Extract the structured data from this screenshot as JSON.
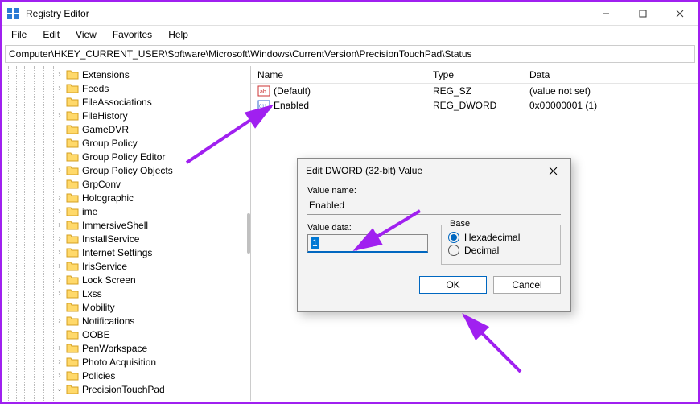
{
  "window": {
    "title": "Registry Editor"
  },
  "menu": {
    "items": [
      "File",
      "Edit",
      "View",
      "Favorites",
      "Help"
    ]
  },
  "address": "Computer\\HKEY_CURRENT_USER\\Software\\Microsoft\\Windows\\CurrentVersion\\PrecisionTouchPad\\Status",
  "tree": {
    "items": [
      {
        "label": "Extensions",
        "exp": "closed"
      },
      {
        "label": "Feeds",
        "exp": "closed"
      },
      {
        "label": "FileAssociations",
        "exp": "none"
      },
      {
        "label": "FileHistory",
        "exp": "closed"
      },
      {
        "label": "GameDVR",
        "exp": "none"
      },
      {
        "label": "Group Policy",
        "exp": "none"
      },
      {
        "label": "Group Policy Editor",
        "exp": "none"
      },
      {
        "label": "Group Policy Objects",
        "exp": "closed"
      },
      {
        "label": "GrpConv",
        "exp": "none"
      },
      {
        "label": "Holographic",
        "exp": "closed"
      },
      {
        "label": "ime",
        "exp": "closed"
      },
      {
        "label": "ImmersiveShell",
        "exp": "closed"
      },
      {
        "label": "InstallService",
        "exp": "closed"
      },
      {
        "label": "Internet Settings",
        "exp": "closed"
      },
      {
        "label": "IrisService",
        "exp": "closed"
      },
      {
        "label": "Lock Screen",
        "exp": "closed"
      },
      {
        "label": "Lxss",
        "exp": "closed"
      },
      {
        "label": "Mobility",
        "exp": "none"
      },
      {
        "label": "Notifications",
        "exp": "closed"
      },
      {
        "label": "OOBE",
        "exp": "none"
      },
      {
        "label": "PenWorkspace",
        "exp": "closed"
      },
      {
        "label": "Photo Acquisition",
        "exp": "closed"
      },
      {
        "label": "Policies",
        "exp": "closed"
      },
      {
        "label": "PrecisionTouchPad",
        "exp": "open"
      }
    ]
  },
  "list": {
    "columns": {
      "name": "Name",
      "type": "Type",
      "data": "Data"
    },
    "rows": [
      {
        "icon": "string",
        "name": "(Default)",
        "type": "REG_SZ",
        "data": "(value not set)"
      },
      {
        "icon": "binary",
        "name": "Enabled",
        "type": "REG_DWORD",
        "data": "0x00000001 (1)"
      }
    ]
  },
  "dialog": {
    "title": "Edit DWORD (32-bit) Value",
    "name_label": "Value name:",
    "name_value": "Enabled",
    "data_label": "Value data:",
    "data_value": "1",
    "base_label": "Base",
    "hex_label": "Hexadecimal",
    "dec_label": "Decimal",
    "ok": "OK",
    "cancel": "Cancel"
  }
}
